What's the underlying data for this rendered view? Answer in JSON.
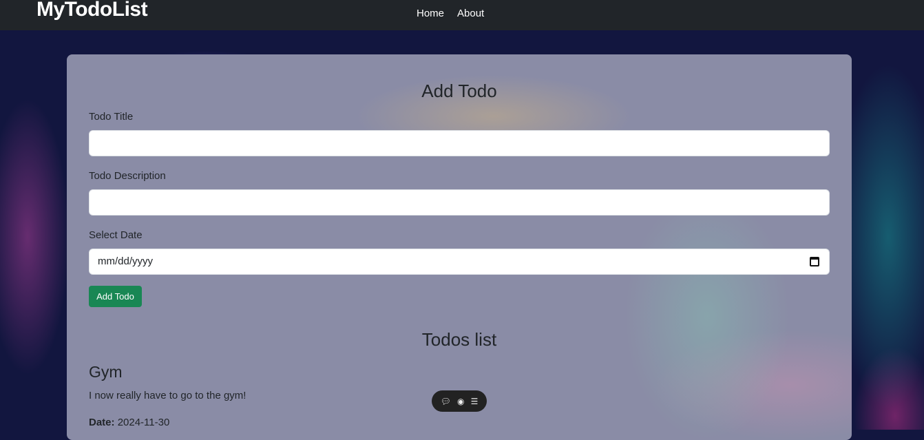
{
  "navbar": {
    "brand": "MyTodoList",
    "links": [
      "Home",
      "About"
    ]
  },
  "form": {
    "heading": "Add Todo",
    "title_label": "Todo Title",
    "title_value": "",
    "description_label": "Todo Description",
    "description_value": "",
    "date_label": "Select Date",
    "date_placeholder": "mm/dd/yyyy",
    "submit_label": "Add Todo"
  },
  "list": {
    "heading": "Todos list",
    "items": [
      {
        "title": "Gym",
        "description": "I now really have to go to the gym!",
        "date_label": "Date:",
        "date": "2024-11-30"
      }
    ]
  },
  "floating_toolbar": {
    "icons": [
      "chat-icon",
      "eye-icon",
      "list-icon"
    ]
  },
  "colors": {
    "navbar": "#212529",
    "button": "#198754",
    "background": "#12163f"
  }
}
